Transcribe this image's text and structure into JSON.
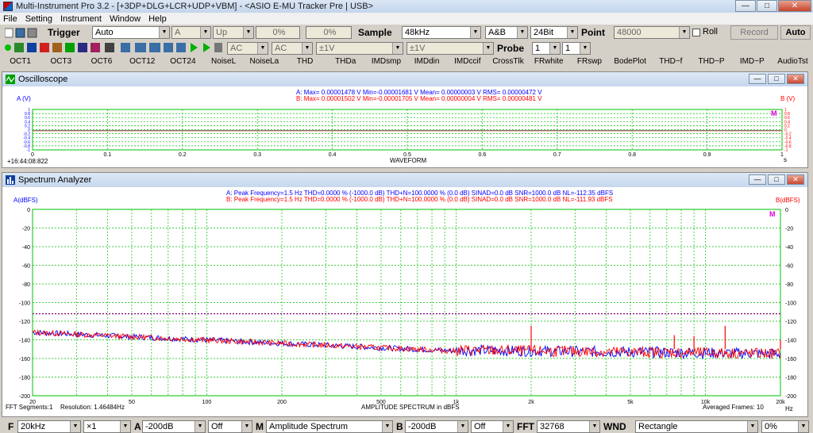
{
  "window": {
    "title": "Multi-Instrument Pro 3.2   -  [+3DP+DLG+LCR+UDP+VBM]   -  <ASIO E-MU Tracker Pre | USB>",
    "minimize": "—",
    "maximize": "□",
    "close": "✕"
  },
  "menu": [
    "File",
    "Setting",
    "Instrument",
    "Window",
    "Help"
  ],
  "toolbar1": {
    "trigger_label": "Trigger",
    "trigger_mode": "Auto",
    "channel": "A",
    "edge": "Up",
    "level_pct": "0%",
    "delay_pct": "0%",
    "sample_label": "Sample",
    "sample_rate": "48kHz",
    "channels": "A&B",
    "bits": "24Bit",
    "point_label": "Point",
    "points": "48000",
    "roll_label": "Roll",
    "record_label": "Record",
    "auto_label": "Auto"
  },
  "toolbar2": {
    "coupling_a": "AC",
    "coupling_b": "AC",
    "range_a": "±1V",
    "range_b": "±1V",
    "probe_label": "Probe",
    "probe_a": "1",
    "probe_b": "1"
  },
  "toolbar3": [
    "OCT1",
    "OCT3",
    "OCT6",
    "OCT12",
    "OCT24",
    "NoiseL",
    "NoiseLa",
    "THD",
    "THDa",
    "IMDsmp",
    "IMDdin",
    "IMDccif",
    "CrossTlk",
    "FRwhite",
    "FRswp",
    "BodePlot",
    "THD~f",
    "THD~P",
    "IMD~P",
    "AudioTst"
  ],
  "oscilloscope": {
    "title": "Oscilloscope",
    "axis_a": "A (V)",
    "axis_b": "B (V)",
    "stats_a": "A: Max= 0.00001478 V  Min=-0.00001681 V  Mean= 0.00000003 V  RMS= 0.00000472 V",
    "stats_b": "B: Max= 0.00001502 V  Min=-0.00001705 V  Mean= 0.00000004 V  RMS= 0.00000481 V",
    "x_ticks": [
      "0",
      "0.1",
      "0.2",
      "0.3",
      "0.4",
      "0.5",
      "0.6",
      "0.7",
      "0.8",
      "0.9",
      "1"
    ],
    "y_ticks": [
      "1",
      "0.8",
      "0.6",
      "0.4",
      "0.2",
      "0",
      "-0.2",
      "-0.4",
      "-0.6",
      "-0.8",
      "-1"
    ],
    "xlabel": "WAVEFORM",
    "xunit": "s",
    "timestamp": "+16:44:08:822",
    "marker": "M"
  },
  "spectrum": {
    "title": "Spectrum Analyzer",
    "axis_a": "A(dBFS)",
    "axis_b": "B(dBFS)",
    "stats_a": "A: Peak Frequency=1.5 Hz  THD=0.0000 % (-1000.0 dB)  THD+N=100.0000 % (0.0 dB)  SINAD=0.0 dB  SNR=1000.0 dB  NL=-112.35 dBFS",
    "stats_b": "B: Peak Frequency=1.5 Hz  THD=0.0000 % (-1000.0 dB)  THD+N=100.0000 % (0.0 dB)  SINAD=0.0 dB  SNR=1000.0 dB  NL=-111.93 dBFS",
    "y_ticks": [
      "0",
      "-20",
      "-40",
      "-60",
      "-80",
      "-100",
      "-120",
      "-140",
      "-160",
      "-180",
      "-200"
    ],
    "x_ticks": [
      "20",
      "50",
      "100",
      "200",
      "500",
      "1k",
      "2k",
      "5k",
      "10k",
      "20k"
    ],
    "xlabel": "AMPLITUDE SPECTRUM in dBFS",
    "xunit": "Hz",
    "fft_segments": "FFT Segments:1",
    "resolution": "Resolution: 1.46484Hz",
    "averaged": "Averaged Frames: 10",
    "marker": "M"
  },
  "bottombar": {
    "f_label": "F",
    "freq_range": "20kHz",
    "zoom": "×1",
    "a_label": "A",
    "a_floor": "-200dB",
    "a_off": "Off",
    "m_label": "M",
    "mode": "Amplitude Spectrum",
    "b_label": "B",
    "b_floor": "-200dB",
    "b_off": "Off",
    "fft_label": "FFT",
    "fft_size": "32768",
    "wnd_label": "WND",
    "window": "Rectangle",
    "overlap": "0%"
  },
  "colors": {
    "grid": "#00c000",
    "channel_a": "#0000ff",
    "channel_b": "#ff0000",
    "noise_line": "#800080",
    "header_bg": "#c6d8ee"
  }
}
